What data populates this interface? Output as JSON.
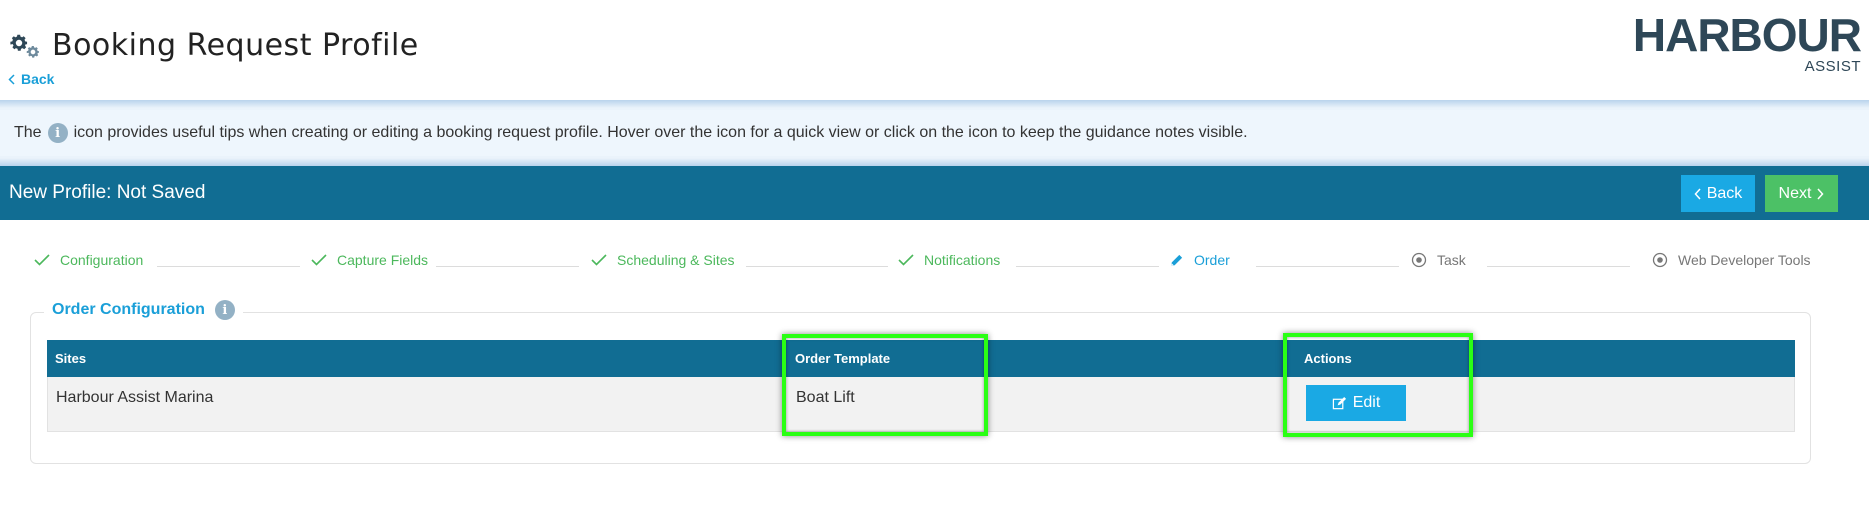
{
  "header": {
    "title": "Booking Request Profile",
    "back_label": "Back",
    "logo_main": "HARBOUR",
    "logo_sub": "ASSIST"
  },
  "tip": {
    "before": "The",
    "icon": "info-icon",
    "after": "icon provides useful tips when creating or editing a booking request profile. Hover over the icon for a quick view or click on the icon to keep the guidance notes visible."
  },
  "profile_bar": {
    "title": "New Profile: Not Saved",
    "back_label": "Back",
    "next_label": "Next"
  },
  "steps": [
    {
      "label": "Configuration",
      "state": "done"
    },
    {
      "label": "Capture Fields",
      "state": "done"
    },
    {
      "label": "Scheduling & Sites",
      "state": "done"
    },
    {
      "label": "Notifications",
      "state": "done"
    },
    {
      "label": "Order",
      "state": "active"
    },
    {
      "label": "Task",
      "state": "todo"
    },
    {
      "label": "Web Developer Tools",
      "state": "todo"
    }
  ],
  "order_config": {
    "title": "Order Configuration",
    "columns": [
      "Sites",
      "Order Template",
      "Actions"
    ],
    "rows": [
      {
        "site": "Harbour Assist Marina",
        "template": "Boat Lift",
        "action_label": "Edit"
      }
    ]
  },
  "colors": {
    "primary_bar": "#116d93",
    "accent_blue": "#1aa9e4",
    "success_green": "#4cc166",
    "highlight_green": "#2aff14"
  }
}
